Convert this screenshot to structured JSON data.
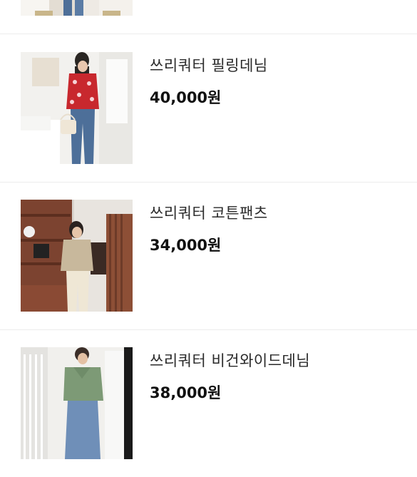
{
  "products": [
    {
      "title": "",
      "price": ""
    },
    {
      "title": "쓰리쿼터 필링데님",
      "price": "40,000원"
    },
    {
      "title": "쓰리쿼터 코튼팬츠",
      "price": "34,000원"
    },
    {
      "title": "쓰리쿼터 비건와이드데님",
      "price": "38,000원"
    }
  ]
}
